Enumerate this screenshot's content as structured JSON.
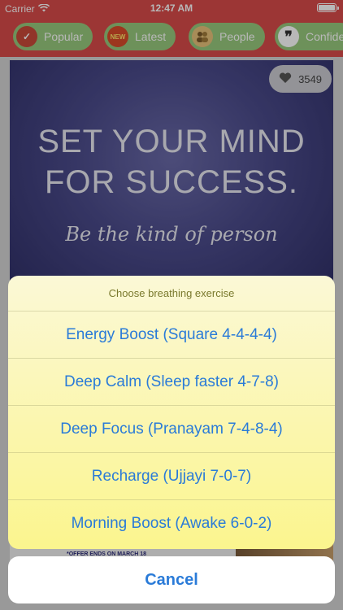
{
  "status_bar": {
    "carrier": "Carrier",
    "time": "12:47 AM",
    "battery_level": 1.0
  },
  "categories": [
    {
      "label": "Popular",
      "icon": "check-badge-icon"
    },
    {
      "label": "Latest",
      "icon": "new-badge-icon",
      "icon_text": "NEW"
    },
    {
      "label": "People",
      "icon": "people-icon"
    },
    {
      "label": "Confide",
      "icon": "quote-icon"
    }
  ],
  "quote_card": {
    "line1": "SET YOUR MIND",
    "line2": "FOR SUCCESS.",
    "line3": "Be the kind of person",
    "like_count": "3549",
    "offer_text": "*OFFER ENDS ON MARCH 18"
  },
  "action_sheet": {
    "title": "Choose breathing exercise",
    "options": [
      "Energy Boost (Square 4-4-4-4)",
      "Deep Calm (Sleep faster 4-7-8)",
      "Deep Focus (Pranayam 7-4-8-4)",
      "Recharge (Ujjayi 7-0-7)",
      "Morning Boost (Awake 6-0-2)"
    ],
    "cancel": "Cancel"
  },
  "colors": {
    "header": "#d84c4a",
    "pill": "#98c97d",
    "action_text": "#2a7bd8"
  }
}
